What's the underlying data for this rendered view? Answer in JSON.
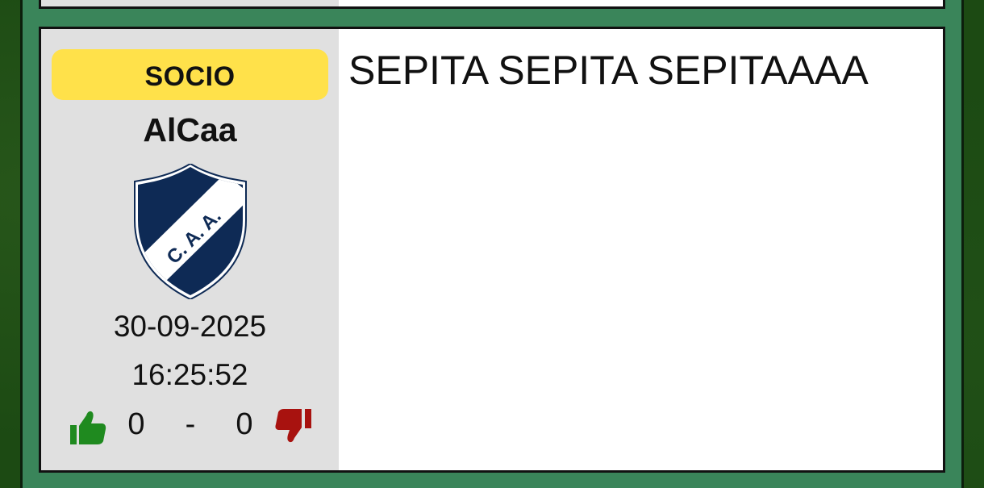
{
  "post": {
    "badge": "SOCIO",
    "username": "AlCaa",
    "date": "30-09-2025",
    "time": "16:25:52",
    "likes": "0",
    "separator": "-",
    "dislikes": "0",
    "message": "SEPITA SEPITA SEPITAAAA",
    "crest_text": "C. A. A."
  },
  "colors": {
    "background": "#1c4a13",
    "frame": "#3a855a",
    "badge": "#ffe14a",
    "sidebar": "#e0e0e0",
    "crest_blue": "#0e2a55",
    "like_green": "#1f8a1f",
    "dislike_red": "#a8120f"
  },
  "icons": {
    "like": "thumbs-up-icon",
    "dislike": "thumbs-down-icon",
    "avatar": "club-crest-icon"
  }
}
